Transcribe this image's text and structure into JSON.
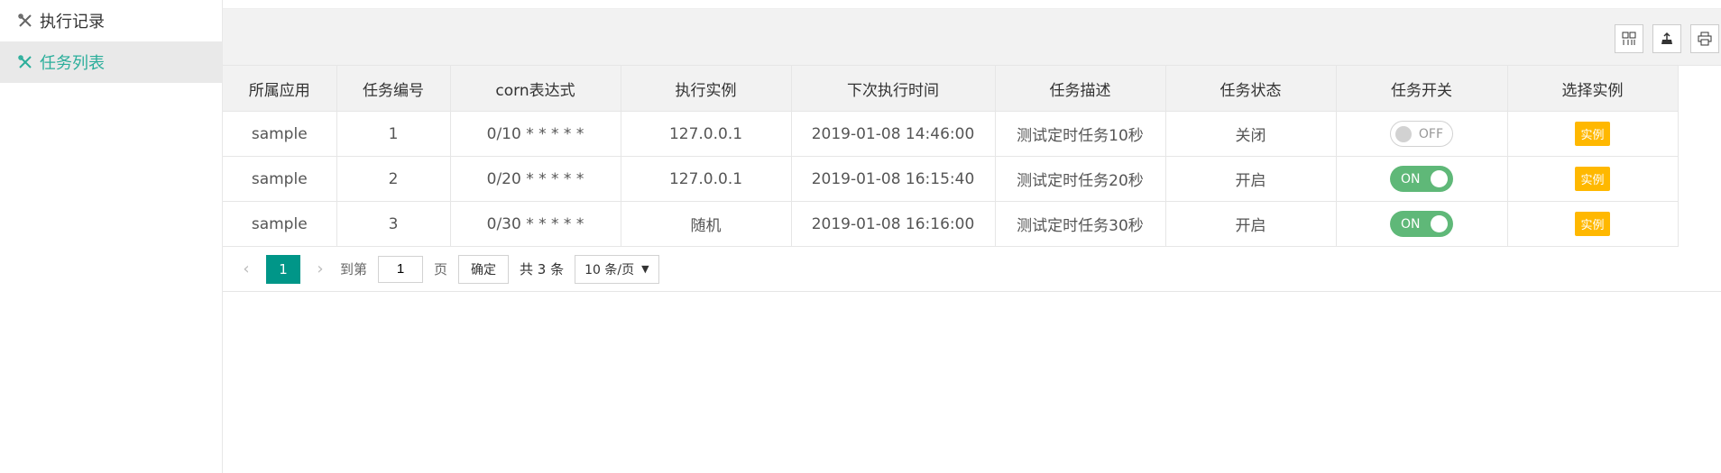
{
  "sidebar": {
    "items": [
      {
        "label": "执行记录",
        "icon": "tools-icon"
      },
      {
        "label": "任务列表",
        "icon": "tools-icon"
      }
    ]
  },
  "toolbar": {
    "icons": [
      "columns-filter-icon",
      "export-icon",
      "print-icon"
    ]
  },
  "table": {
    "headers": [
      "所属应用",
      "任务编号",
      "corn表达式",
      "执行实例",
      "下次执行时间",
      "任务描述",
      "任务状态",
      "任务开关",
      "选择实例"
    ],
    "rows": [
      {
        "app": "sample",
        "id": "1",
        "cron": "0/10 * * * * *",
        "instance": "127.0.0.1",
        "next": "2019-01-08 14:46:00",
        "desc": "测试定时任务10秒",
        "status": "关闭",
        "switch": "OFF",
        "action": "实例"
      },
      {
        "app": "sample",
        "id": "2",
        "cron": "0/20 * * * * *",
        "instance": "127.0.0.1",
        "next": "2019-01-08 16:15:40",
        "desc": "测试定时任务20秒",
        "status": "开启",
        "switch": "ON",
        "action": "实例"
      },
      {
        "app": "sample",
        "id": "3",
        "cron": "0/30 * * * * *",
        "instance": "随机",
        "next": "2019-01-08 16:16:00",
        "desc": "测试定时任务30秒",
        "status": "开启",
        "switch": "ON",
        "action": "实例"
      }
    ]
  },
  "pager": {
    "current": "1",
    "goto_label": "到第",
    "goto_value": "1",
    "page_unit": "页",
    "confirm": "确定",
    "total": "共 3 条",
    "page_size": "10 条/页"
  },
  "colors": {
    "accent": "#009688",
    "on": "#5fb878",
    "badge": "#ffb800",
    "active_text": "#2bae9b"
  }
}
